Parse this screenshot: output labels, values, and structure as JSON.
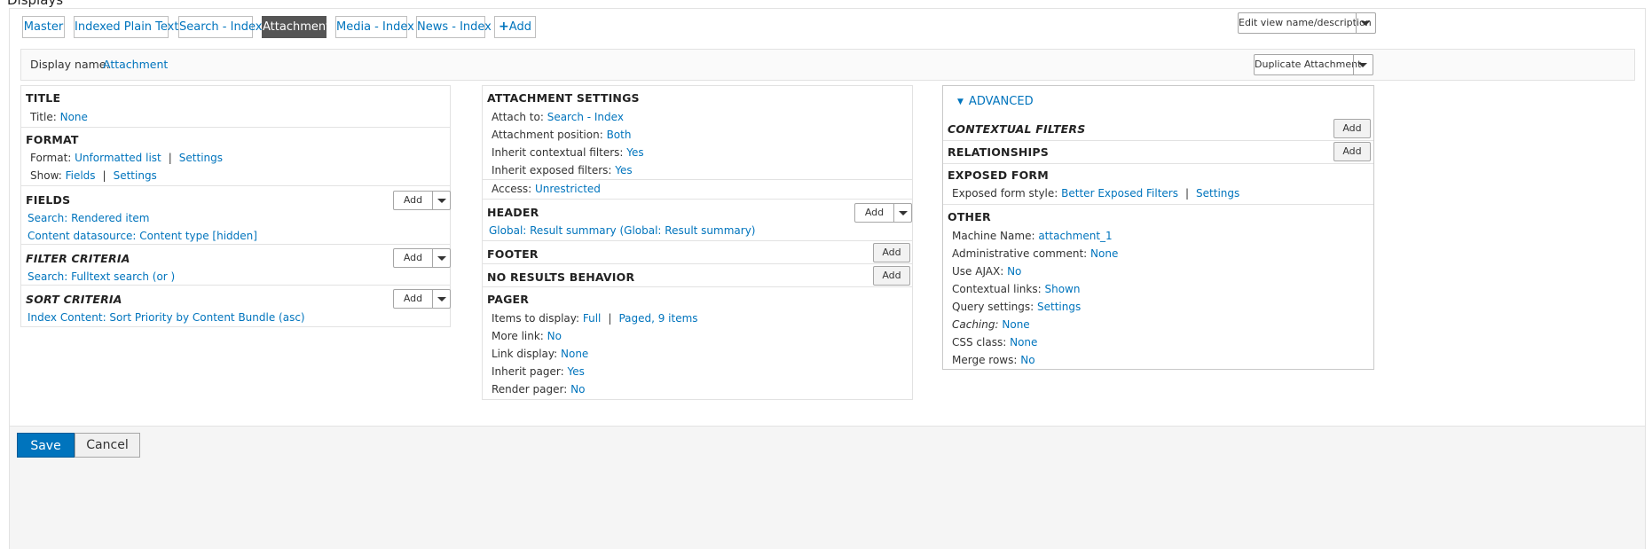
{
  "page": {
    "heading": "Displays"
  },
  "tabs": [
    {
      "label": "Master"
    },
    {
      "label": "Indexed Plain Text"
    },
    {
      "label": "Search - Index"
    },
    {
      "label": "Attachment"
    },
    {
      "label": "Media - Index"
    },
    {
      "label": "News - Index"
    },
    {
      "label": "Add",
      "icon": "plus-icon"
    }
  ],
  "actions": {
    "edit_view_label": "Edit view name/description",
    "duplicate_label": "Duplicate Attachment"
  },
  "display_name": {
    "label": "Display name:",
    "value": "Attachment"
  },
  "left": {
    "title": {
      "heading": "TITLE",
      "key": "Title:",
      "value": "None"
    },
    "format": {
      "heading": "FORMAT",
      "format_key": "Format:",
      "format_value": "Unformatted list",
      "format_settings": "Settings",
      "show_key": "Show:",
      "show_value": "Fields",
      "show_settings": "Settings"
    },
    "fields": {
      "heading": "FIELDS",
      "add_label": "Add",
      "items": [
        "Search: Rendered item",
        "Content datasource: Content type [hidden]"
      ]
    },
    "filter": {
      "heading": "FILTER CRITERIA",
      "add_label": "Add",
      "items": [
        "Search: Fulltext search (or )"
      ]
    },
    "sort": {
      "heading": "SORT CRITERIA",
      "add_label": "Add",
      "items": [
        "Index Content: Sort Priority by Content Bundle (asc)"
      ]
    }
  },
  "middle": {
    "attachment": {
      "heading": "ATTACHMENT SETTINGS",
      "rows": [
        {
          "key": "Attach to:",
          "value": "Search - Index"
        },
        {
          "key": "Attachment position:",
          "value": "Both"
        },
        {
          "key": "Inherit contextual filters:",
          "value": "Yes"
        },
        {
          "key": "Inherit exposed filters:",
          "value": "Yes"
        }
      ],
      "access_key": "Access:",
      "access_value": "Unrestricted"
    },
    "header": {
      "heading": "HEADER",
      "add_label": "Add",
      "items": [
        "Global: Result summary (Global: Result summary)"
      ]
    },
    "footer": {
      "heading": "FOOTER",
      "add_label": "Add"
    },
    "no_results": {
      "heading": "NO RESULTS BEHAVIOR",
      "add_label": "Add"
    },
    "pager": {
      "heading": "PAGER",
      "items_key": "Items to display:",
      "items_value": "Full",
      "items_value2": "Paged, 9 items",
      "rows": [
        {
          "key": "More link:",
          "value": "No"
        },
        {
          "key": "Link display:",
          "value": "None"
        },
        {
          "key": "Inherit pager:",
          "value": "Yes"
        },
        {
          "key": "Render pager:",
          "value": "No"
        }
      ]
    }
  },
  "right": {
    "advanced_label": "ADVANCED",
    "contextual": {
      "heading": "CONTEXTUAL FILTERS",
      "add_label": "Add"
    },
    "relationships": {
      "heading": "RELATIONSHIPS",
      "add_label": "Add"
    },
    "exposed": {
      "heading": "EXPOSED FORM",
      "key": "Exposed form style:",
      "value": "Better Exposed Filters",
      "settings": "Settings"
    },
    "other": {
      "heading": "OTHER",
      "rows": [
        {
          "key": "Machine Name:",
          "value": "attachment_1"
        },
        {
          "key": "Administrative comment:",
          "value": "None"
        },
        {
          "key": "Use AJAX:",
          "value": "No"
        },
        {
          "key": "Contextual links:",
          "value": "Shown"
        },
        {
          "key": "Query settings:",
          "value": "Settings"
        },
        {
          "key": "Caching:",
          "value": "None"
        },
        {
          "key": "CSS class:",
          "value": "None"
        },
        {
          "key": "Merge rows:",
          "value": "No"
        }
      ]
    }
  },
  "form": {
    "save_label": "Save",
    "cancel_label": "Cancel"
  },
  "colors": {
    "link": "#0074bd",
    "active_tab": "#555555",
    "save": "#0074bd"
  }
}
